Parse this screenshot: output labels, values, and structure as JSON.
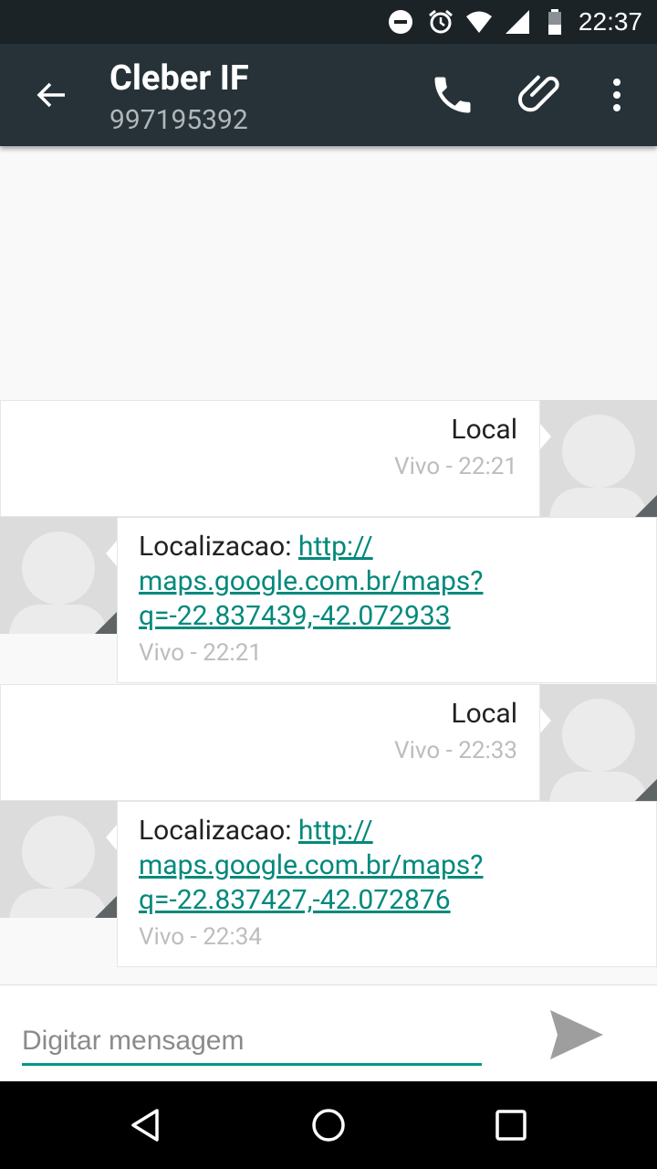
{
  "status_bar": {
    "time": "22:37",
    "icons": [
      "do-not-disturb-icon",
      "alarm-icon",
      "wifi-icon",
      "cell-signal-icon",
      "battery-icon"
    ]
  },
  "action_bar": {
    "title": "Cleber IF",
    "subtitle": "997195392",
    "icons": [
      "back-arrow-icon",
      "phone-icon",
      "attach-icon",
      "overflow-menu-icon"
    ]
  },
  "messages": [
    {
      "direction": "outgoing",
      "text": "Local",
      "meta": "Vivo - 22:21"
    },
    {
      "direction": "incoming",
      "prefix": "Localizacao: ",
      "link_line1": "http://",
      "link_line2": "maps.google.com.br/maps?",
      "link_line3": "q=-22.837439,-42.072933",
      "meta": "Vivo - 22:21"
    },
    {
      "direction": "outgoing",
      "text": "Local",
      "meta": "Vivo - 22:33"
    },
    {
      "direction": "incoming",
      "prefix": "Localizacao: ",
      "link_line1": "http://",
      "link_line2": "maps.google.com.br/maps?",
      "link_line3": "q=-22.837427,-42.072876",
      "meta": "Vivo - 22:34"
    }
  ],
  "compose": {
    "placeholder": "Digitar mensagem",
    "value": ""
  },
  "colors": {
    "status_bar": "#1b2327",
    "action_bar": "#263238",
    "accent": "#009688",
    "link": "#00897b"
  }
}
